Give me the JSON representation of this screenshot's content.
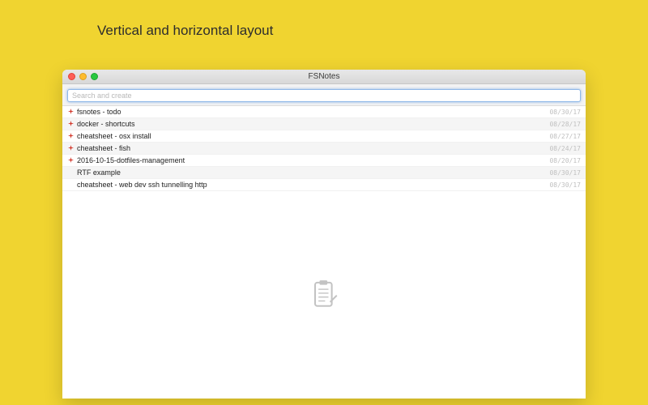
{
  "page": {
    "heading": "Vertical and horizontal layout"
  },
  "window": {
    "title": "FSNotes",
    "search_placeholder": "Search and create"
  },
  "notes": [
    {
      "pinned": true,
      "title": "fsnotes - todo",
      "date": "08/30/17"
    },
    {
      "pinned": true,
      "title": "docker - shortcuts",
      "date": "08/28/17"
    },
    {
      "pinned": true,
      "title": "cheatsheet - osx install",
      "date": "08/27/17"
    },
    {
      "pinned": true,
      "title": "cheatsheet - fish",
      "date": "08/24/17"
    },
    {
      "pinned": true,
      "title": "2016-10-15-dotfiles-management",
      "date": "08/20/17"
    },
    {
      "pinned": false,
      "title": "RTF example",
      "date": "08/30/17"
    },
    {
      "pinned": false,
      "title": "cheatsheet - web dev ssh tunnelling http",
      "date": "08/30/17"
    }
  ],
  "colors": {
    "background": "#f0d430",
    "pin": "#d33b2f"
  }
}
